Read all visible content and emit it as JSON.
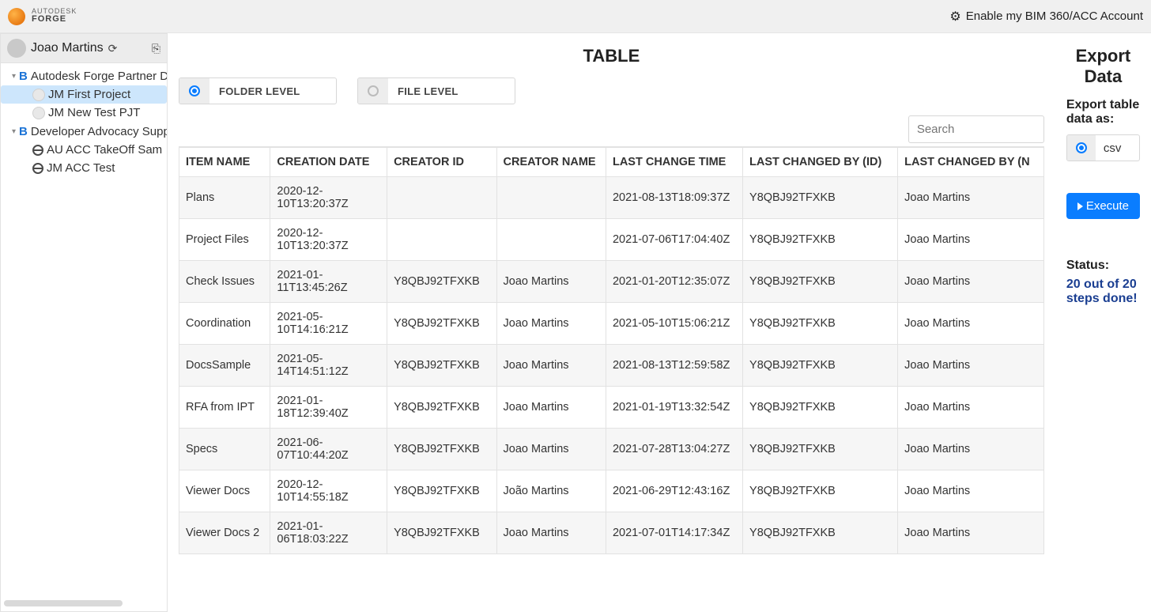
{
  "header": {
    "brand_top": "AUTODESK",
    "brand_bottom": "FORGE",
    "account_link": "Enable my BIM 360/ACC Account"
  },
  "sidebar": {
    "user_name": "Joao Martins",
    "hubs": [
      {
        "label": "Autodesk Forge Partner D",
        "type": "hub-b",
        "children": [
          {
            "label": "JM First Project",
            "type": "project",
            "selected": true
          },
          {
            "label": "JM New Test PJT",
            "type": "project"
          }
        ]
      },
      {
        "label": "Developer Advocacy Supp",
        "type": "hub-b",
        "children": [
          {
            "label": "AU ACC TakeOff Sam",
            "type": "globe"
          },
          {
            "label": "JM ACC Test",
            "type": "globe"
          }
        ]
      }
    ]
  },
  "table_section": {
    "title": "TABLE",
    "folder_level_label": "FOLDER LEVEL",
    "file_level_label": "FILE LEVEL",
    "level_selected": "folder",
    "search_placeholder": "Search",
    "columns": [
      "ITEM NAME",
      "CREATION DATE",
      "CREATOR ID",
      "CREATOR NAME",
      "LAST CHANGE TIME",
      "LAST CHANGED BY (ID)",
      "LAST CHANGED BY (N"
    ],
    "rows": [
      {
        "item": "Plans",
        "cdate": "2020-12-10T13:20:37Z",
        "cid": "",
        "cname": "",
        "ltime": "2021-08-13T18:09:37Z",
        "lid": "Y8QBJ92TFXKB",
        "lname": "Joao Martins"
      },
      {
        "item": "Project Files",
        "cdate": "2020-12-10T13:20:37Z",
        "cid": "",
        "cname": "",
        "ltime": "2021-07-06T17:04:40Z",
        "lid": "Y8QBJ92TFXKB",
        "lname": "Joao Martins"
      },
      {
        "item": "Check Issues",
        "cdate": "2021-01-11T13:45:26Z",
        "cid": "Y8QBJ92TFXKB",
        "cname": "Joao Martins",
        "ltime": "2021-01-20T12:35:07Z",
        "lid": "Y8QBJ92TFXKB",
        "lname": "Joao Martins"
      },
      {
        "item": "Coordination",
        "cdate": "2021-05-10T14:16:21Z",
        "cid": "Y8QBJ92TFXKB",
        "cname": "Joao Martins",
        "ltime": "2021-05-10T15:06:21Z",
        "lid": "Y8QBJ92TFXKB",
        "lname": "Joao Martins"
      },
      {
        "item": "DocsSample",
        "cdate": "2021-05-14T14:51:12Z",
        "cid": "Y8QBJ92TFXKB",
        "cname": "Joao Martins",
        "ltime": "2021-08-13T12:59:58Z",
        "lid": "Y8QBJ92TFXKB",
        "lname": "Joao Martins"
      },
      {
        "item": "RFA from IPT",
        "cdate": "2021-01-18T12:39:40Z",
        "cid": "Y8QBJ92TFXKB",
        "cname": "Joao Martins",
        "ltime": "2021-01-19T13:32:54Z",
        "lid": "Y8QBJ92TFXKB",
        "lname": "Joao Martins"
      },
      {
        "item": "Specs",
        "cdate": "2021-06-07T10:44:20Z",
        "cid": "Y8QBJ92TFXKB",
        "cname": "Joao Martins",
        "ltime": "2021-07-28T13:04:27Z",
        "lid": "Y8QBJ92TFXKB",
        "lname": "Joao Martins"
      },
      {
        "item": "Viewer Docs",
        "cdate": "2020-12-10T14:55:18Z",
        "cid": "Y8QBJ92TFXKB",
        "cname": "João Martins",
        "ltime": "2021-06-29T12:43:16Z",
        "lid": "Y8QBJ92TFXKB",
        "lname": "Joao Martins"
      },
      {
        "item": "Viewer Docs 2",
        "cdate": "2021-01-06T18:03:22Z",
        "cid": "Y8QBJ92TFXKB",
        "cname": "Joao Martins",
        "ltime": "2021-07-01T14:17:34Z",
        "lid": "Y8QBJ92TFXKB",
        "lname": "Joao Martins"
      }
    ]
  },
  "export": {
    "title": "Export Data",
    "label": "Export table data as:",
    "format": "csv",
    "button": "Execute",
    "status_heading": "Status:",
    "status_message": "20 out of 20 steps done!"
  }
}
